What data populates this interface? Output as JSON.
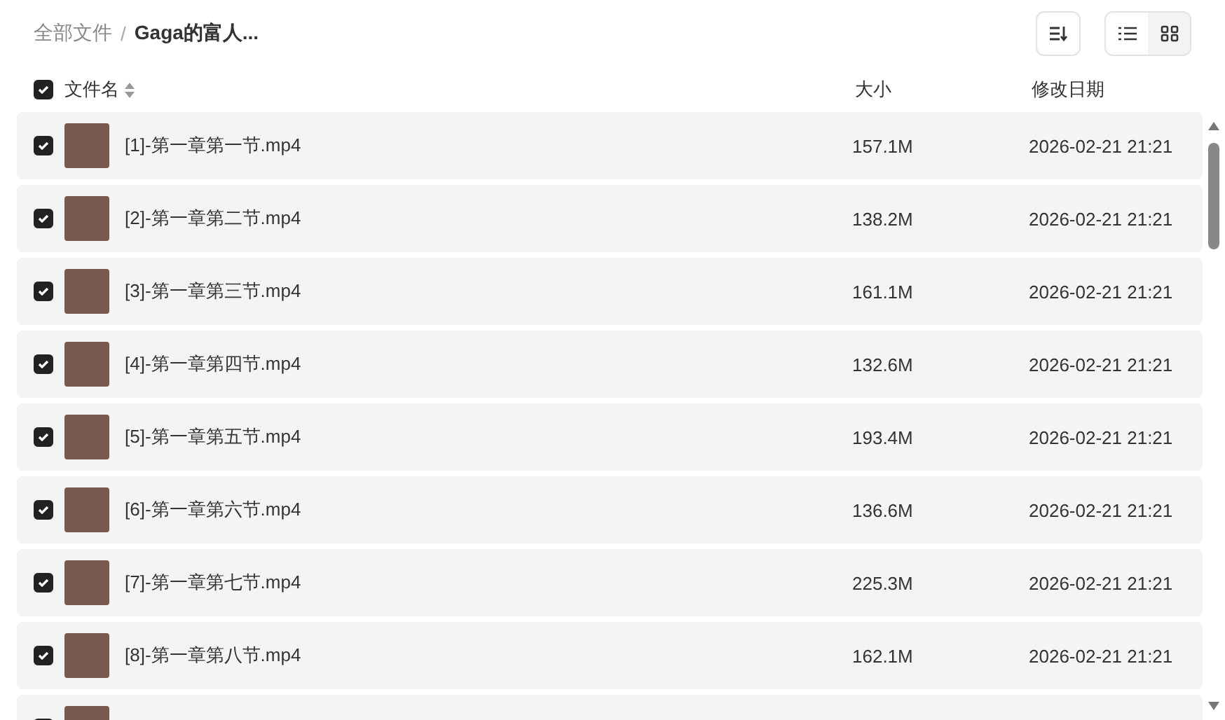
{
  "breadcrumb": {
    "root": "全部文件",
    "separator": "/",
    "current": "Gaga的富人..."
  },
  "view_toggle": {
    "list_selected": true
  },
  "header": {
    "checked": true,
    "name": "文件名",
    "size": "大小",
    "date": "修改日期"
  },
  "rows": [
    {
      "checked": true,
      "name": "[1]-第一章第一节.mp4",
      "size": "157.1M",
      "date": "2026-02-21 21:21"
    },
    {
      "checked": true,
      "name": "[2]-第一章第二节.mp4",
      "size": "138.2M",
      "date": "2026-02-21 21:21"
    },
    {
      "checked": true,
      "name": "[3]-第一章第三节.mp4",
      "size": "161.1M",
      "date": "2026-02-21 21:21"
    },
    {
      "checked": true,
      "name": "[4]-第一章第四节.mp4",
      "size": "132.6M",
      "date": "2026-02-21 21:21"
    },
    {
      "checked": true,
      "name": "[5]-第一章第五节.mp4",
      "size": "193.4M",
      "date": "2026-02-21 21:21"
    },
    {
      "checked": true,
      "name": "[6]-第一章第六节.mp4",
      "size": "136.6M",
      "date": "2026-02-21 21:21"
    },
    {
      "checked": true,
      "name": "[7]-第一章第七节.mp4",
      "size": "225.3M",
      "date": "2026-02-21 21:21"
    },
    {
      "checked": true,
      "name": "[8]-第一章第八节.mp4",
      "size": "162.1M",
      "date": "2026-02-21 21:21"
    },
    {
      "checked": true
    }
  ]
}
